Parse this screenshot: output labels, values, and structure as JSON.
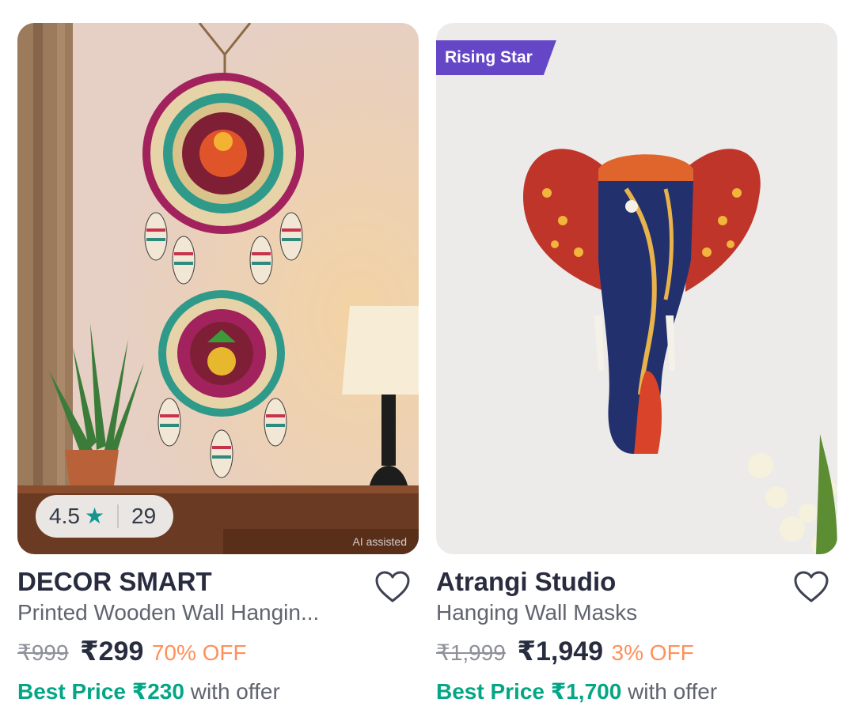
{
  "products": [
    {
      "brand": "DECOR SMART",
      "name": "Printed Wooden Wall Hangin...",
      "mrp": "₹999",
      "price": "₹299",
      "discount": "70% OFF",
      "best_price": "Best Price ₹230",
      "offer_suffix": "with offer",
      "rating": "4.5",
      "rating_count": "29",
      "ai_label": "AI assisted",
      "wishlisted": false
    },
    {
      "brand": "Atrangi Studio",
      "name": "Hanging Wall Masks",
      "mrp": "₹1,999",
      "price": "₹1,949",
      "discount": "3% OFF",
      "best_price": "Best Price ₹1,700",
      "offer_suffix": "with offer",
      "badge": "Rising Star",
      "wishlisted": false
    }
  ],
  "colors": {
    "badge": "#6546c7",
    "discount": "#ff905a",
    "best_price": "#03a685",
    "rating_star": "#14958f",
    "brand_text": "#282c3f"
  }
}
